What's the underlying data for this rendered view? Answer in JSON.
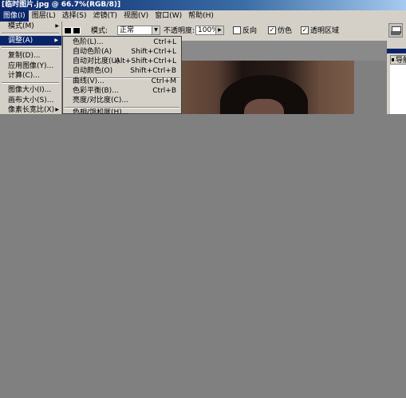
{
  "window": {
    "title": "[临时图片.jpg @ 66.7%(RGB/8)]"
  },
  "menubar": {
    "items": [
      "图像(I)",
      "图层(L)",
      "选择(S)",
      "滤镜(T)",
      "视图(V)",
      "窗口(W)",
      "帮助(H)"
    ]
  },
  "toolbar": {
    "mode_label": "模式:",
    "mode_value": "正常",
    "opacity_label": "不透明度:",
    "opacity_value": "100%",
    "reverse_label": "反向",
    "dither_label": "仿色",
    "transparency_label": "透明区域",
    "reverse_checked": "",
    "dither_checked": "✓",
    "transparency_checked": "✓"
  },
  "image_menu": {
    "items": [
      "模式(M)",
      "调整(A)",
      "复制(D)...",
      "应用图像(Y)...",
      "计算(C)...",
      "图像大小(I)...",
      "画布大小(S)...",
      "像素长宽比(X)"
    ]
  },
  "adjust_submenu": {
    "items": [
      {
        "label": "色阶(L)...",
        "shortcut": "Ctrl+L"
      },
      {
        "label": "自动色阶(A)",
        "shortcut": "Shift+Ctrl+L"
      },
      {
        "label": "自动对比度(U)",
        "shortcut": "Alt+Shift+Ctrl+L"
      },
      {
        "label": "自动颜色(O)",
        "shortcut": "Shift+Ctrl+B"
      },
      {
        "label": "曲线(V)...",
        "shortcut": "Ctrl+M"
      },
      {
        "label": "色彩平衡(B)...",
        "shortcut": "Ctrl+B"
      },
      {
        "label": "亮度/对比度(C)...",
        "shortcut": ""
      },
      {
        "label": "色相/饱和度(H)...",
        "shortcut": ""
      }
    ]
  },
  "navigator": {
    "tab_label": "导航"
  }
}
